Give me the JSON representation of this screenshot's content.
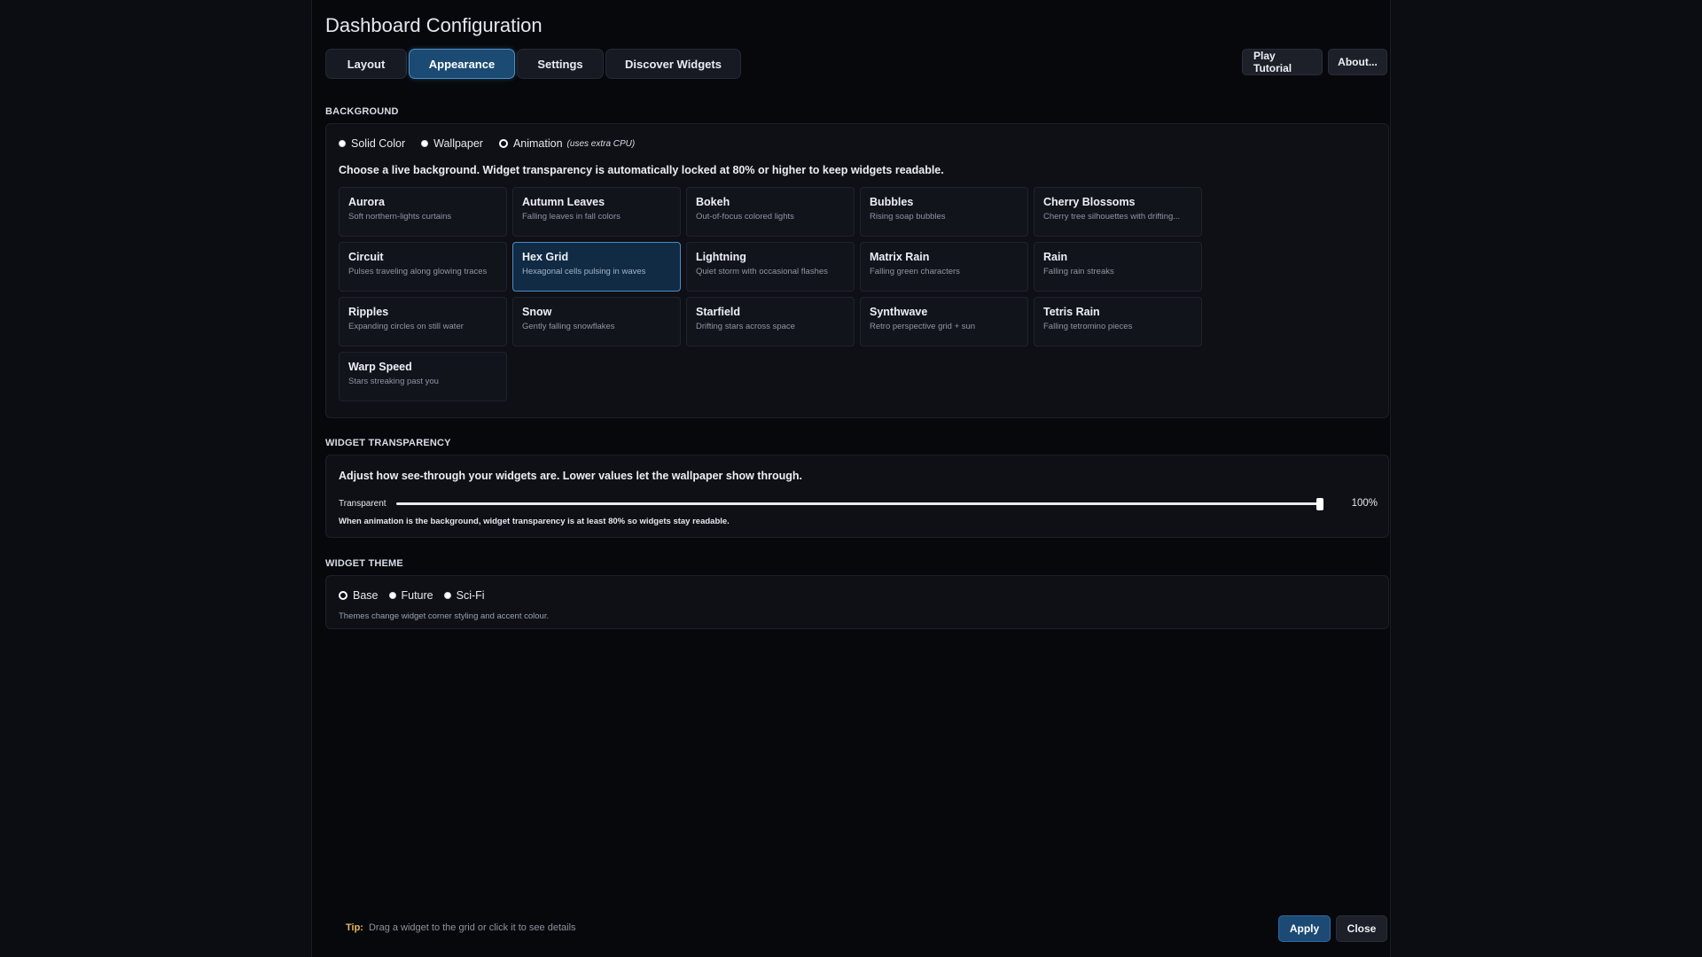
{
  "title": "Dashboard Configuration",
  "tabs": [
    {
      "label": "Layout"
    },
    {
      "label": "Appearance",
      "active": true
    },
    {
      "label": "Settings"
    },
    {
      "label": "Discover Widgets"
    }
  ],
  "top_buttons": {
    "tutorial": "Play Tutorial",
    "about": "About..."
  },
  "background": {
    "label": "BACKGROUND",
    "options": [
      {
        "label": "Solid Color",
        "checked": false
      },
      {
        "label": "Wallpaper",
        "checked": false
      },
      {
        "label": "Animation",
        "hint": "(uses extra CPU)",
        "checked": true
      }
    ],
    "description": "Choose a live background. Widget transparency is automatically locked at 80% or higher to keep widgets readable.",
    "animations": [
      {
        "name": "Aurora",
        "desc": "Soft northern-lights curtains"
      },
      {
        "name": "Autumn Leaves",
        "desc": "Falling leaves in fall colors"
      },
      {
        "name": "Bokeh",
        "desc": "Out-of-focus colored lights"
      },
      {
        "name": "Bubbles",
        "desc": "Rising soap bubbles"
      },
      {
        "name": "Cherry Blossoms",
        "desc": "Cherry tree silhouettes with drifting..."
      },
      {
        "name": "Circuit",
        "desc": "Pulses traveling along glowing traces"
      },
      {
        "name": "Hex Grid",
        "desc": "Hexagonal cells pulsing in waves",
        "selected": true
      },
      {
        "name": "Lightning",
        "desc": "Quiet storm with occasional flashes"
      },
      {
        "name": "Matrix Rain",
        "desc": "Falling green characters"
      },
      {
        "name": "Rain",
        "desc": "Falling rain streaks"
      },
      {
        "name": "Ripples",
        "desc": "Expanding circles on still water"
      },
      {
        "name": "Snow",
        "desc": "Gently falling snowflakes"
      },
      {
        "name": "Starfield",
        "desc": "Drifting stars across space"
      },
      {
        "name": "Synthwave",
        "desc": "Retro perspective grid + sun"
      },
      {
        "name": "Tetris Rain",
        "desc": "Falling tetromino pieces"
      },
      {
        "name": "Warp Speed",
        "desc": "Stars streaking past you"
      }
    ]
  },
  "transparency": {
    "label": "WIDGET TRANSPARENCY",
    "description": "Adjust how see-through your widgets are. Lower values let the wallpaper show through.",
    "slider_label": "Transparent",
    "value": 100,
    "value_text": "100%",
    "note": "When animation is the background, widget transparency is at least 80% so widgets stay readable."
  },
  "theme": {
    "label": "WIDGET THEME",
    "options": [
      {
        "label": "Base",
        "checked": true
      },
      {
        "label": "Future",
        "checked": false
      },
      {
        "label": "Sci-Fi",
        "checked": false
      }
    ],
    "note": "Themes change widget corner styling and accent colour."
  },
  "footer": {
    "tip_label": "Tip:",
    "tip_text": "Drag a widget to the grid or click it to see details",
    "apply": "Apply",
    "close": "Close"
  },
  "colors": {
    "accent": "#4a8cc6",
    "tab_active_bg": "#1b4a72",
    "tip_label": "#e9b85d"
  }
}
